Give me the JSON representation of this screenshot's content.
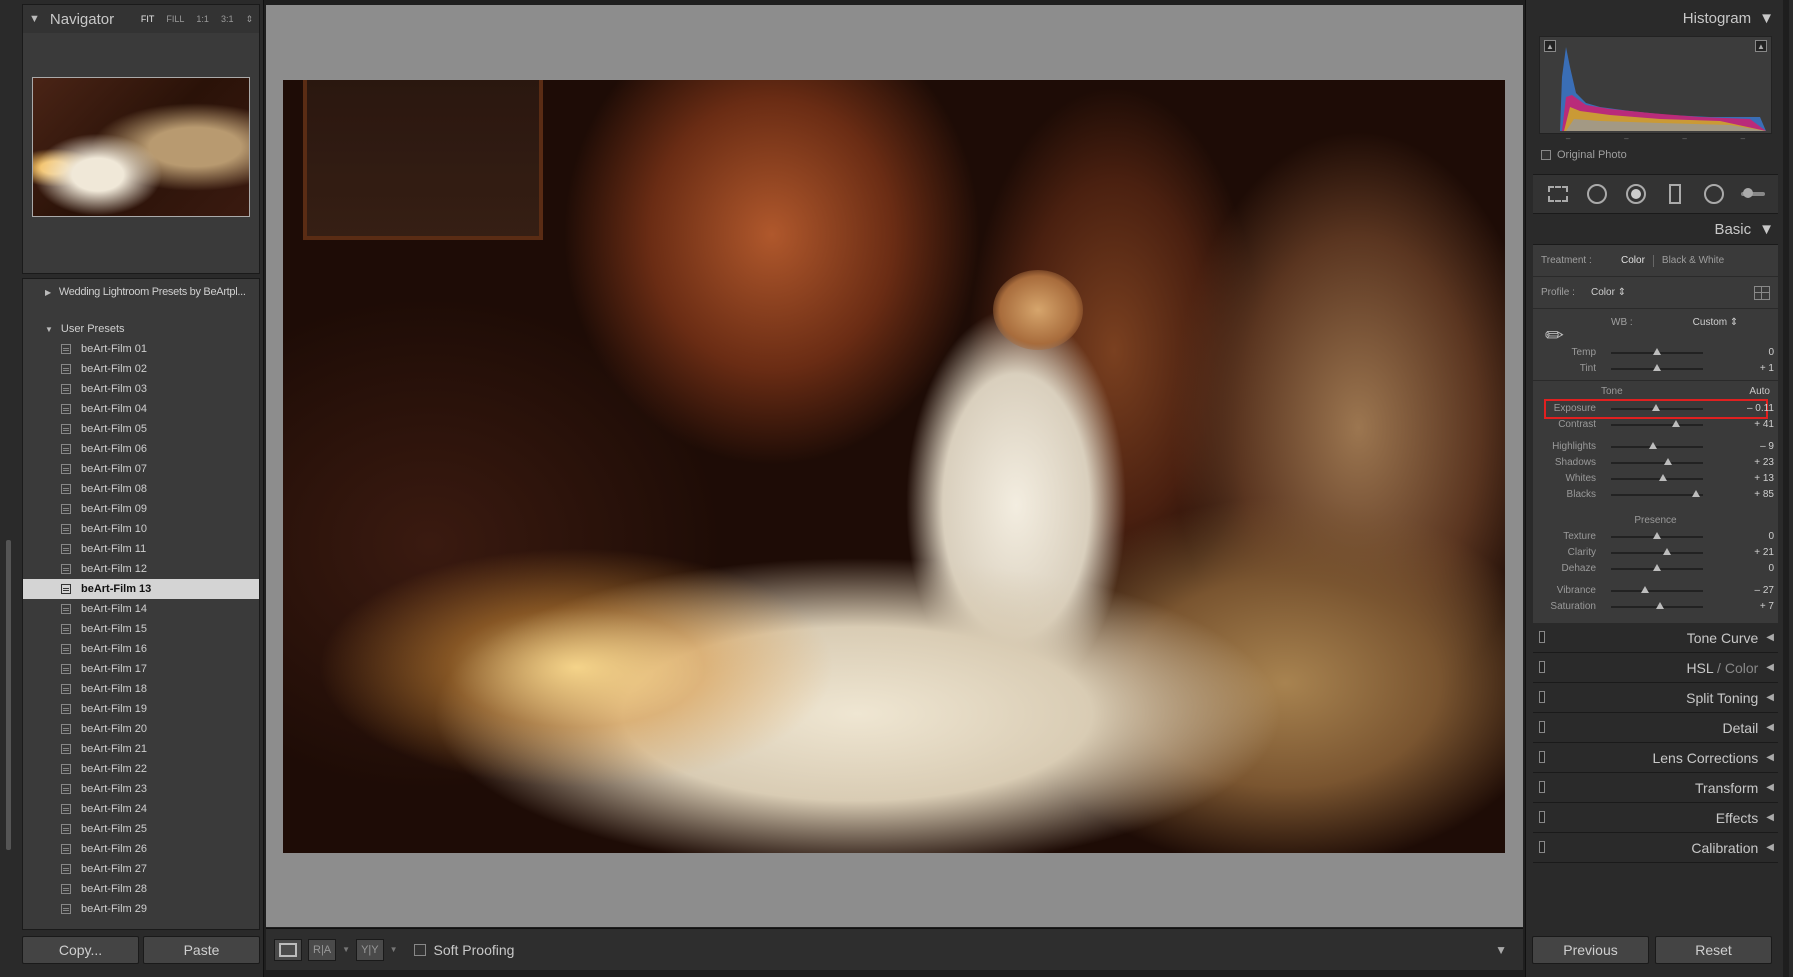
{
  "navigator": {
    "title": "Navigator",
    "zoom": [
      "FIT",
      "FILL",
      "1:1",
      "3:1"
    ]
  },
  "presets": {
    "collection": "Wedding Lightroom Presets by BeArtpl...",
    "user_group": "User Presets",
    "items": [
      "beArt-Film 01",
      "beArt-Film 02",
      "beArt-Film 03",
      "beArt-Film 04",
      "beArt-Film 05",
      "beArt-Film 06",
      "beArt-Film 07",
      "beArt-Film 08",
      "beArt-Film 09",
      "beArt-Film 10",
      "beArt-Film 11",
      "beArt-Film 12",
      "beArt-Film 13",
      "beArt-Film 14",
      "beArt-Film 15",
      "beArt-Film 16",
      "beArt-Film 17",
      "beArt-Film 18",
      "beArt-Film 19",
      "beArt-Film 20",
      "beArt-Film 21",
      "beArt-Film 22",
      "beArt-Film 23",
      "beArt-Film 24",
      "beArt-Film 25",
      "beArt-Film 26",
      "beArt-Film 27",
      "beArt-Film 28",
      "beArt-Film 29"
    ],
    "selected_index": 12
  },
  "left_buttons": {
    "copy": "Copy...",
    "paste": "Paste"
  },
  "toolbar": {
    "soft_proofing": "Soft Proofing"
  },
  "histogram": {
    "title": "Histogram",
    "original_photo": "Original Photo"
  },
  "basic": {
    "title": "Basic",
    "treatment_label": "Treatment :",
    "treatment_color": "Color",
    "treatment_bw": "Black & White",
    "profile_label": "Profile :",
    "profile_value": "Color",
    "wb_label": "WB :",
    "wb_value": "Custom",
    "tone_label": "Tone",
    "auto_label": "Auto",
    "presence_label": "Presence",
    "sliders": {
      "temp": {
        "label": "Temp",
        "value": "0",
        "level": 0.5
      },
      "tint": {
        "label": "Tint",
        "value": "+ 1",
        "level": 0.505
      },
      "exposure": {
        "label": "Exposure",
        "value": "– 0.11",
        "level": 0.49
      },
      "contrast": {
        "label": "Contrast",
        "value": "+ 41",
        "level": 0.705
      },
      "highlights": {
        "label": "Highlights",
        "value": "– 9",
        "level": 0.455
      },
      "shadows": {
        "label": "Shadows",
        "value": "+ 23",
        "level": 0.615
      },
      "whites": {
        "label": "Whites",
        "value": "+ 13",
        "level": 0.565
      },
      "blacks": {
        "label": "Blacks",
        "value": "+ 85",
        "level": 0.925
      },
      "texture": {
        "label": "Texture",
        "value": "0",
        "level": 0.5
      },
      "clarity": {
        "label": "Clarity",
        "value": "+ 21",
        "level": 0.605
      },
      "dehaze": {
        "label": "Dehaze",
        "value": "0",
        "level": 0.5
      },
      "vibrance": {
        "label": "Vibrance",
        "value": "– 27",
        "level": 0.365
      },
      "saturation": {
        "label": "Saturation",
        "value": "+ 7",
        "level": 0.535
      }
    }
  },
  "panels": {
    "tone_curve": "Tone Curve",
    "hsl": "HSL",
    "hsl_sep": " / ",
    "color": "Color",
    "split_toning": "Split Toning",
    "detail": "Detail",
    "lens": "Lens Corrections",
    "transform": "Transform",
    "effects": "Effects",
    "calibration": "Calibration"
  },
  "right_buttons": {
    "previous": "Previous",
    "reset": "Reset"
  },
  "colors": {
    "highlight": "#e02020",
    "panel_bg": "#3a3a3a",
    "canvas_bg": "#8d8d8d"
  }
}
